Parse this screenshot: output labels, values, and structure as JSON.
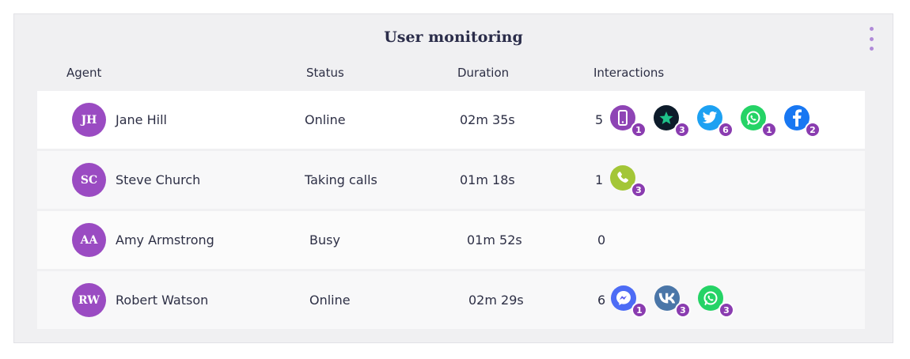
{
  "panel": {
    "title": "User monitoring",
    "menu_icon": "vertical-dots-icon"
  },
  "columns": {
    "agent": "Agent",
    "status": "Status",
    "duration": "Duration",
    "interactions": "Interactions"
  },
  "rows": [
    {
      "initials": "JH",
      "name": "Jane Hill",
      "status": "Online",
      "duration": "02m 35s",
      "interactions_total": "5",
      "channels": [
        {
          "icon": "mobile-phone-icon",
          "count": "1",
          "color": "#8e44b5"
        },
        {
          "icon": "star-review-icon",
          "count": "3",
          "color": "#0d1b2a"
        },
        {
          "icon": "twitter-icon",
          "count": "6",
          "color": "#1da1f2"
        },
        {
          "icon": "whatsapp-icon",
          "count": "1",
          "color": "#25d366"
        },
        {
          "icon": "facebook-icon",
          "count": "2",
          "color": "#1877f2"
        }
      ]
    },
    {
      "initials": "SC",
      "name": "Steve Church",
      "status": "Taking calls",
      "duration": "01m 18s",
      "interactions_total": "1",
      "channels": [
        {
          "icon": "phone-call-icon",
          "count": "3",
          "color": "#a3c637"
        }
      ]
    },
    {
      "initials": "AA",
      "name": "Amy Armstrong",
      "status": "Busy",
      "duration": "01m 52s",
      "interactions_total": "0",
      "channels": []
    },
    {
      "initials": "RW",
      "name": "Robert Watson",
      "status": "Online",
      "duration": "02m 29s",
      "interactions_total": "6",
      "channels": [
        {
          "icon": "messenger-icon",
          "count": "1",
          "color": "#4d6cf5"
        },
        {
          "icon": "vk-icon",
          "count": "3",
          "color": "#4a76a8"
        },
        {
          "icon": "whatsapp-icon",
          "count": "3",
          "color": "#25d366"
        }
      ]
    }
  ],
  "colors": {
    "avatar": "#9a4bc2",
    "badge": "#8a3cb0",
    "menu_dots": "#b08ad8"
  }
}
